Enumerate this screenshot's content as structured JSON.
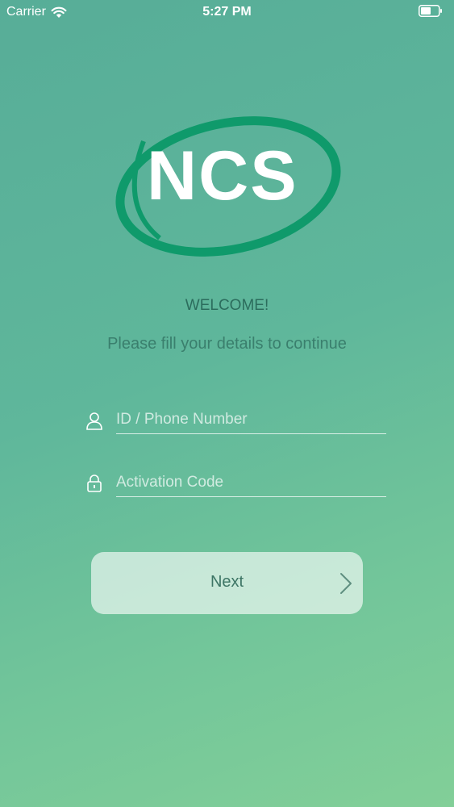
{
  "status_bar": {
    "carrier": "Carrier",
    "time": "5:27 PM"
  },
  "logo": {
    "text": "NCS",
    "ring_color": "#0f9a6b"
  },
  "welcome": {
    "title": "WELCOME!",
    "subtitle": "Please fill your details to continue"
  },
  "form": {
    "id_placeholder": "ID / Phone Number",
    "id_value": "",
    "code_placeholder": "Activation Code",
    "code_value": ""
  },
  "next_button": {
    "label": "Next"
  },
  "icons": [
    "wifi-icon",
    "battery-icon",
    "user-icon",
    "lock-icon",
    "chevron-right-icon"
  ]
}
